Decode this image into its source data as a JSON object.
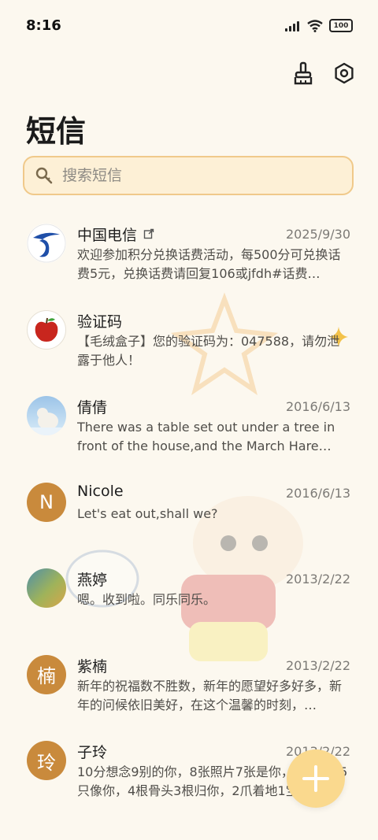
{
  "status_bar": {
    "time": "8:16",
    "battery": "100"
  },
  "page_title": "短信",
  "search": {
    "placeholder": "搜索短信"
  },
  "messages": [
    {
      "name": "中国电信",
      "date": "2025/9/30",
      "preview": "欢迎参加积分兑换话费活动，每500分可兑换话费5元，兑换话费请回复106或jfdh#话费…",
      "avatar": "china-telecom-logo"
    },
    {
      "name": "验证码",
      "date": "",
      "preview": "【毛绒盒子】您的验证码为：047588，请勿泄露于他人！",
      "avatar": "apple-avatar"
    },
    {
      "name": "倩倩",
      "date": "2016/6/13",
      "preview": "There was a table set out under a tree in front of the house,and the March Hare an…",
      "avatar": "polar-bear-photo"
    },
    {
      "name": "Nicole",
      "date": "2016/6/13",
      "preview": "Let's eat out,shall we?",
      "avatar_letter": "N"
    },
    {
      "name": "燕婷",
      "date": "2013/2/22",
      "preview": "嗯。收到啦。同乐同乐。",
      "avatar": "landscape-photo"
    },
    {
      "name": "紫楠",
      "date": "2013/2/22",
      "preview": "新年的祝福数不胜数，新年的愿望好多好多，新年的问候依旧美好，在这个温馨的时刻，…",
      "avatar_letter": "楠"
    },
    {
      "name": "子玲",
      "date": "2013/2/22",
      "preview": "10分想念9别的你，8张照片7张是你，6只小狗5只像你，4根骨头3根归你，2爪着地1宝…",
      "avatar_letter": "玲"
    }
  ],
  "colors": {
    "accent": "#fad98e",
    "search_border": "#f0c98a",
    "letter_avatar": "#c98a3c",
    "background": "#fcf8ef"
  },
  "icons": [
    "brush-icon",
    "settings-icon",
    "search-icon",
    "sparkle-icon",
    "plus-icon"
  ]
}
